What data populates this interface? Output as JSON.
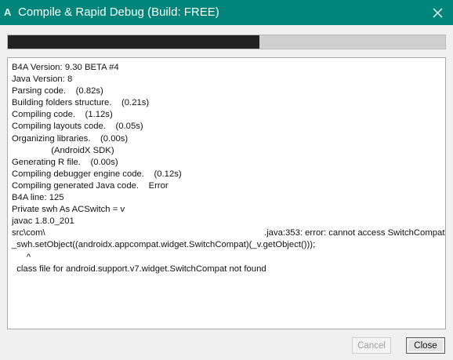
{
  "window": {
    "app_icon": "A",
    "title": "Compile & Rapid Debug (Build: FREE)",
    "accent_color": "#00857a"
  },
  "progress": {
    "value_fraction": 0.575,
    "fill_color": "#222222",
    "track_color": "#cfcfcf"
  },
  "log": {
    "lines": [
      "B4A Version: 9.30 BETA #4",
      "Java Version: 8",
      "Parsing code.    (0.82s)",
      "Building folders structure.    (0.21s)",
      "Compiling code.    (1.12s)",
      "Compiling layouts code.    (0.05s)",
      "Organizing libraries.    (0.00s)",
      "                (AndroidX SDK)",
      "Generating R file.    (0.00s)",
      "Compiling debugger engine code.    (0.12s)",
      "Compiling generated Java code.    Error",
      "B4A line: 125",
      "Private swh As ACSwitch = v",
      "javac 1.8.0_201",
      "src\\com\\                                                                                         .java:353: error: cannot access SwitchCompat",
      "_swh.setObject((androidx.appcompat.widget.SwitchCompat)(_v.getObject()));",
      "      ^",
      "  class file for android.support.v7.widget.SwitchCompat not found"
    ]
  },
  "buttons": {
    "cancel": "Cancel",
    "close": "Close"
  }
}
